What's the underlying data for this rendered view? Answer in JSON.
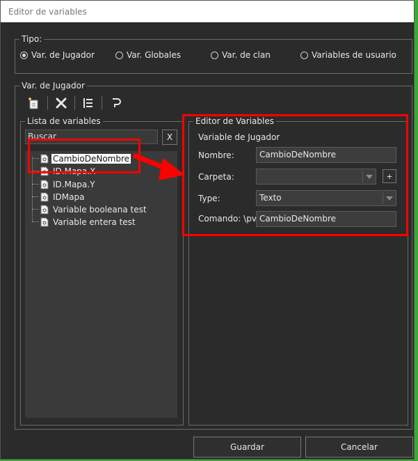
{
  "window": {
    "title": "Editor de variables"
  },
  "tipo": {
    "legend": "Tipo:",
    "options": [
      {
        "label": "Var. de Jugador",
        "selected": true
      },
      {
        "label": "Var. Globales",
        "selected": false
      },
      {
        "label": "Var. de clan",
        "selected": false
      },
      {
        "label": "Variables de usuario",
        "selected": false
      }
    ]
  },
  "var_group": {
    "legend": "Var. de Jugador"
  },
  "toolbar": {
    "icons": [
      "new-variable-icon",
      "delete-icon",
      "list-icon",
      "undo-icon"
    ]
  },
  "lista": {
    "legend": "Lista de variables",
    "search_value": "Buscar",
    "clear_label": "X",
    "items": [
      {
        "label": "CambioDeNombre",
        "selected": true
      },
      {
        "label": "ID.Mapa.X",
        "selected": false
      },
      {
        "label": "ID.Mapa.Y",
        "selected": false
      },
      {
        "label": "IDMapa",
        "selected": false
      },
      {
        "label": "Variable booleana test",
        "selected": false
      },
      {
        "label": "Variable entera test",
        "selected": false
      }
    ]
  },
  "editor": {
    "legend": "Editor de Variables",
    "subtitle": "Variable de Jugador",
    "nombre_label": "Nombre:",
    "nombre_value": "CambioDeNombre",
    "carpeta_label": "Carpeta:",
    "carpeta_value": "",
    "add_label": "+",
    "type_label": "Type:",
    "type_value": "Texto",
    "comando_label": "Comando: \\pv",
    "comando_value": "CambioDeNombre"
  },
  "buttons": {
    "save": "Guardar",
    "cancel": "Cancelar"
  },
  "colors": {
    "annotation": "#ff0000",
    "background": "#2b2b2b",
    "desktop": "#3aaa32"
  }
}
